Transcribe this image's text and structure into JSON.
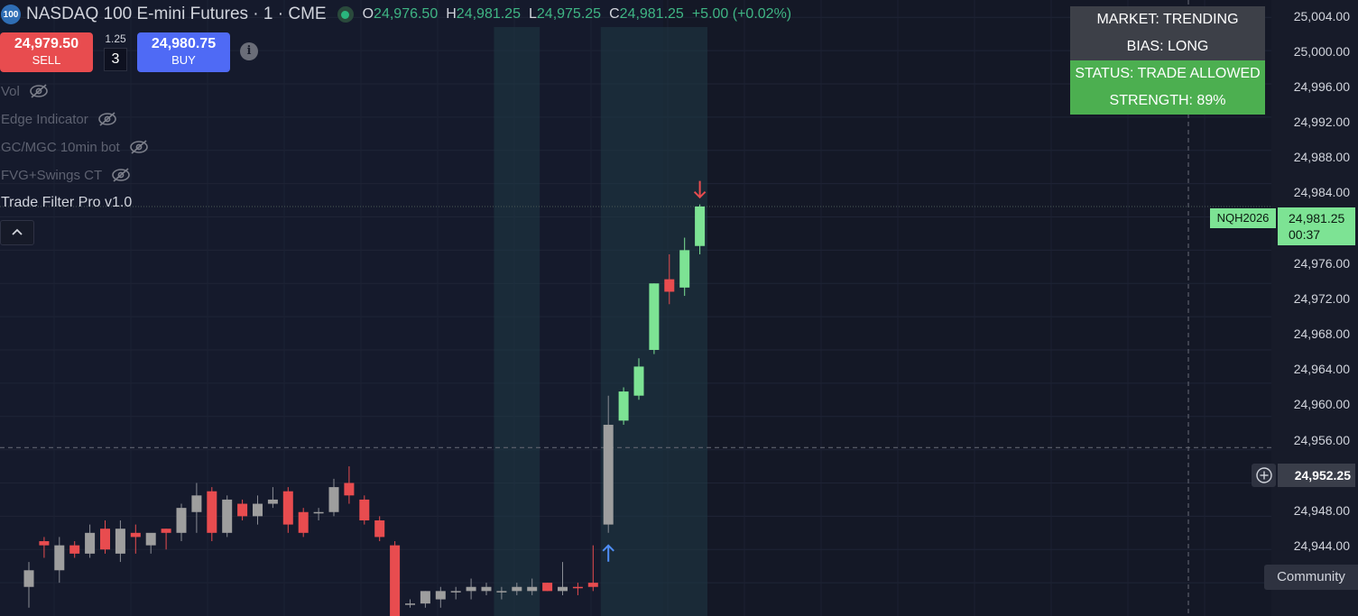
{
  "header": {
    "symbol_badge": "100",
    "title": "NASDAQ 100 E-mini Futures · 1 · CME",
    "ohlc": {
      "o_label": "O",
      "o_value": "24,976.50",
      "h_label": "H",
      "h_value": "24,981.25",
      "l_label": "L",
      "l_value": "24,975.25",
      "c_label": "C",
      "c_value": "24,981.25",
      "change": "+5.00 (+0.02%)"
    }
  },
  "trade": {
    "sell_price": "24,979.50",
    "sell_label": "SELL",
    "spread": "1.25",
    "quantity": "3",
    "buy_price": "24,980.75",
    "buy_label": "BUY",
    "info_glyph": "i"
  },
  "indicators": [
    {
      "name": "Vol",
      "hidden": true
    },
    {
      "name": "Edge Indicator",
      "hidden": true
    },
    {
      "name": "GC/MGC 10min bot",
      "hidden": true
    },
    {
      "name": "FVG+Swings CT",
      "hidden": true
    },
    {
      "name": "Trade Filter Pro v1.0",
      "hidden": false
    }
  ],
  "status_box": {
    "market": "MARKET: TRENDING",
    "bias": "BIAS: LONG",
    "status": "STATUS: TRADE ALLOWED",
    "strength": "STRENGTH: 89%",
    "header_color": "#3d4048",
    "ok_color": "#4caf50"
  },
  "price_axis": {
    "ticks": [
      "25,004.00",
      "25,000.00",
      "24,996.00",
      "24,992.00",
      "24,988.00",
      "24,984.00",
      "24,976.00",
      "24,972.00",
      "24,968.00",
      "24,964.00",
      "24,960.00",
      "24,956.00",
      "24,948.00",
      "24,944.00"
    ],
    "last_price": "24,981.25",
    "countdown": "00:37",
    "contract": "NQH2026",
    "crosshair_price": "24,952.25"
  },
  "community_label": "Community",
  "colors": {
    "up": "#7de394",
    "down": "#e84c4f",
    "neutral": "#9e9e9e",
    "highlight_zone": "#1f3a45",
    "signal_up": "#4f8ef7",
    "signal_down": "#e84c4f"
  },
  "chart_data": {
    "type": "candlestick",
    "bars": [
      {
        "o": 24935.5,
        "h": 24938.5,
        "l": 24933.0,
        "c": 24937.5,
        "color": "neutral"
      },
      {
        "o": 24941.0,
        "h": 24941.5,
        "l": 24939.0,
        "c": 24940.5,
        "color": "down"
      },
      {
        "o": 24937.5,
        "h": 24941.5,
        "l": 24936.0,
        "c": 24940.5,
        "color": "neutral"
      },
      {
        "o": 24940.5,
        "h": 24941.0,
        "l": 24939.0,
        "c": 24939.5,
        "color": "down"
      },
      {
        "o": 24939.5,
        "h": 24943.0,
        "l": 24939.0,
        "c": 24942.0,
        "color": "neutral"
      },
      {
        "o": 24940.0,
        "h": 24943.5,
        "l": 24939.5,
        "c": 24942.5,
        "color": "down"
      },
      {
        "o": 24942.5,
        "h": 24943.5,
        "l": 24938.5,
        "c": 24939.5,
        "color": "neutral"
      },
      {
        "o": 24942.0,
        "h": 24943.0,
        "l": 24939.5,
        "c": 24941.5,
        "color": "down"
      },
      {
        "o": 24940.5,
        "h": 24941.5,
        "l": 24939.5,
        "c": 24942.0,
        "color": "neutral"
      },
      {
        "o": 24942.5,
        "h": 24942.5,
        "l": 24940.0,
        "c": 24942.0,
        "color": "down"
      },
      {
        "o": 24942.0,
        "h": 24945.5,
        "l": 24941.0,
        "c": 24945.0,
        "color": "neutral"
      },
      {
        "o": 24944.5,
        "h": 24948.0,
        "l": 24942.0,
        "c": 24946.5,
        "color": "neutral"
      },
      {
        "o": 24947.0,
        "h": 24947.5,
        "l": 24941.0,
        "c": 24942.0,
        "color": "down"
      },
      {
        "o": 24942.0,
        "h": 24946.5,
        "l": 24941.5,
        "c": 24946.0,
        "color": "neutral"
      },
      {
        "o": 24944.0,
        "h": 24946.0,
        "l": 24943.5,
        "c": 24945.5,
        "color": "down"
      },
      {
        "o": 24944.0,
        "h": 24946.5,
        "l": 24943.0,
        "c": 24945.5,
        "color": "neutral"
      },
      {
        "o": 24945.5,
        "h": 24947.5,
        "l": 24945.0,
        "c": 24946.0,
        "color": "neutral"
      },
      {
        "o": 24947.0,
        "h": 24947.5,
        "l": 24942.0,
        "c": 24943.0,
        "color": "down"
      },
      {
        "o": 24942.0,
        "h": 24945.0,
        "l": 24941.5,
        "c": 24944.5,
        "color": "down"
      },
      {
        "o": 24944.5,
        "h": 24945.0,
        "l": 24943.5,
        "c": 24944.5,
        "color": "neutral"
      },
      {
        "o": 24944.5,
        "h": 24948.5,
        "l": 24944.0,
        "c": 24947.5,
        "color": "neutral"
      },
      {
        "o": 24948.0,
        "h": 24950.0,
        "l": 24945.5,
        "c": 24946.5,
        "color": "down"
      },
      {
        "o": 24946.0,
        "h": 24946.5,
        "l": 24943.0,
        "c": 24943.5,
        "color": "down"
      },
      {
        "o": 24943.5,
        "h": 24944.0,
        "l": 24941.0,
        "c": 24941.5,
        "color": "down"
      },
      {
        "o": 24940.5,
        "h": 24941.0,
        "l": 24930.0,
        "c": 24931.0,
        "color": "down"
      },
      {
        "o": 24933.5,
        "h": 24934.0,
        "l": 24933.0,
        "c": 24933.5,
        "color": "neutral"
      },
      {
        "o": 24935.0,
        "h": 24935.0,
        "l": 24933.0,
        "c": 24933.5,
        "color": "neutral"
      },
      {
        "o": 24935.0,
        "h": 24935.5,
        "l": 24933.0,
        "c": 24934.0,
        "color": "neutral"
      },
      {
        "o": 24935.0,
        "h": 24935.5,
        "l": 24934.0,
        "c": 24935.0,
        "color": "neutral"
      },
      {
        "o": 24935.0,
        "h": 24936.5,
        "l": 24934.0,
        "c": 24935.5,
        "color": "neutral"
      },
      {
        "o": 24935.5,
        "h": 24936.0,
        "l": 24934.5,
        "c": 24935.0,
        "color": "neutral"
      },
      {
        "o": 24935.0,
        "h": 24935.5,
        "l": 24934.0,
        "c": 24935.0,
        "color": "neutral"
      },
      {
        "o": 24935.0,
        "h": 24936.0,
        "l": 24934.5,
        "c": 24935.5,
        "color": "neutral"
      },
      {
        "o": 24935.0,
        "h": 24936.5,
        "l": 24934.5,
        "c": 24935.5,
        "color": "neutral"
      },
      {
        "o": 24936.0,
        "h": 24936.0,
        "l": 24935.0,
        "c": 24935.0,
        "color": "down"
      },
      {
        "o": 24935.0,
        "h": 24938.5,
        "l": 24934.5,
        "c": 24935.5,
        "color": "neutral"
      },
      {
        "o": 24935.5,
        "h": 24936.0,
        "l": 24934.5,
        "c": 24935.5,
        "color": "down"
      },
      {
        "o": 24936.0,
        "h": 24940.5,
        "l": 24935.0,
        "c": 24935.5,
        "color": "down"
      },
      {
        "o": 24943.0,
        "h": 24958.5,
        "l": 24942.0,
        "c": 24955.0,
        "color": "neutral"
      },
      {
        "o": 24955.5,
        "h": 24959.5,
        "l": 24955.0,
        "c": 24959.0,
        "color": "up"
      },
      {
        "o": 24958.5,
        "h": 24963.0,
        "l": 24958.0,
        "c": 24962.0,
        "color": "up"
      },
      {
        "o": 24964.0,
        "h": 24972.0,
        "l": 24963.5,
        "c": 24972.0,
        "color": "up"
      },
      {
        "o": 24972.5,
        "h": 24975.5,
        "l": 24969.5,
        "c": 24971.0,
        "color": "down"
      },
      {
        "o": 24971.5,
        "h": 24977.5,
        "l": 24970.5,
        "c": 24976.0,
        "color": "up"
      },
      {
        "o": 24976.5,
        "h": 24981.5,
        "l": 24975.5,
        "c": 24981.25,
        "color": "up"
      }
    ],
    "highlight_zones": [
      {
        "from_bar": 31,
        "to_bar": 33
      },
      {
        "from_bar": 38,
        "to_bar": 44
      }
    ],
    "signals": [
      {
        "bar": 38,
        "direction": "up"
      },
      {
        "bar": 44,
        "direction": "down"
      }
    ],
    "ylim": [
      24932.0,
      25005.0
    ],
    "last_price": 24981.25,
    "crosshair_price": 24952.25
  }
}
